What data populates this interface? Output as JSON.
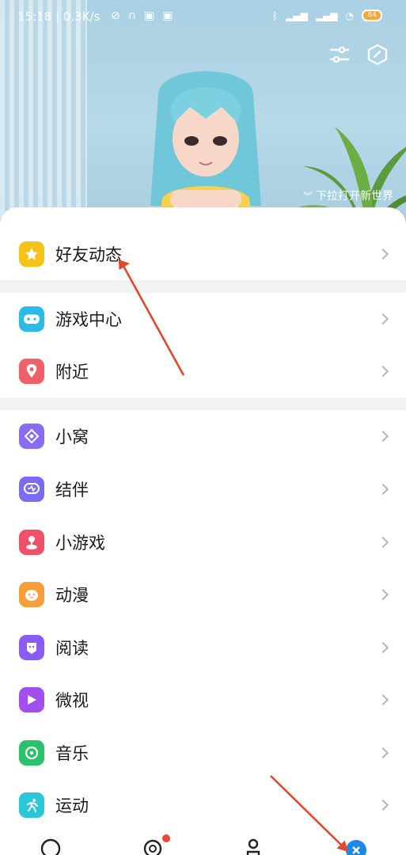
{
  "status_bar": {
    "time": "15:18",
    "network_speed": "0.3K/s",
    "battery_level": "84",
    "icons": [
      "mute-icon",
      "headphones-icon",
      "app-icon",
      "app-icon",
      "bluetooth-icon",
      "signal-hd-icon",
      "signal-hd-icon",
      "wifi-icon",
      "battery-icon"
    ]
  },
  "header": {
    "filter_icon": "sliders-icon",
    "cube_icon": "hexagon-icon",
    "hint": "下拉打开新世界"
  },
  "menu": {
    "groups": [
      {
        "items": [
          {
            "label": "好友动态",
            "icon": "star-icon",
            "color": "#f5c21a"
          }
        ]
      },
      {
        "items": [
          {
            "label": "游戏中心",
            "icon": "gamepad-icon",
            "color": "#2bbbe9"
          },
          {
            "label": "附近",
            "icon": "location-pin-icon",
            "color": "#f0606a"
          }
        ]
      },
      {
        "items": [
          {
            "label": "小窝",
            "icon": "home-icon",
            "color": "#8a6cf3"
          },
          {
            "label": "结伴",
            "icon": "chat-bubble-icon",
            "color": "#7a6cf0"
          },
          {
            "label": "小游戏",
            "icon": "joystick-icon",
            "color": "#f0506a"
          },
          {
            "label": "动漫",
            "icon": "cartoon-face-icon",
            "color": "#f7a03a"
          },
          {
            "label": "阅读",
            "icon": "reader-icon",
            "color": "#8a5cf3"
          },
          {
            "label": "微视",
            "icon": "play-icon",
            "color": "#a24ff0"
          },
          {
            "label": "音乐",
            "icon": "music-disc-icon",
            "color": "#29c46a"
          },
          {
            "label": "运动",
            "icon": "running-icon",
            "color": "#2ac7d8"
          }
        ]
      }
    ]
  },
  "bottom_nav": {
    "items": [
      {
        "icon": "message-icon"
      },
      {
        "icon": "contacts-icon",
        "has_badge": true
      },
      {
        "icon": "profile-icon"
      },
      {
        "icon": "close-circle-icon",
        "color": "#1e88e5"
      }
    ]
  },
  "accent": "#e2472b"
}
